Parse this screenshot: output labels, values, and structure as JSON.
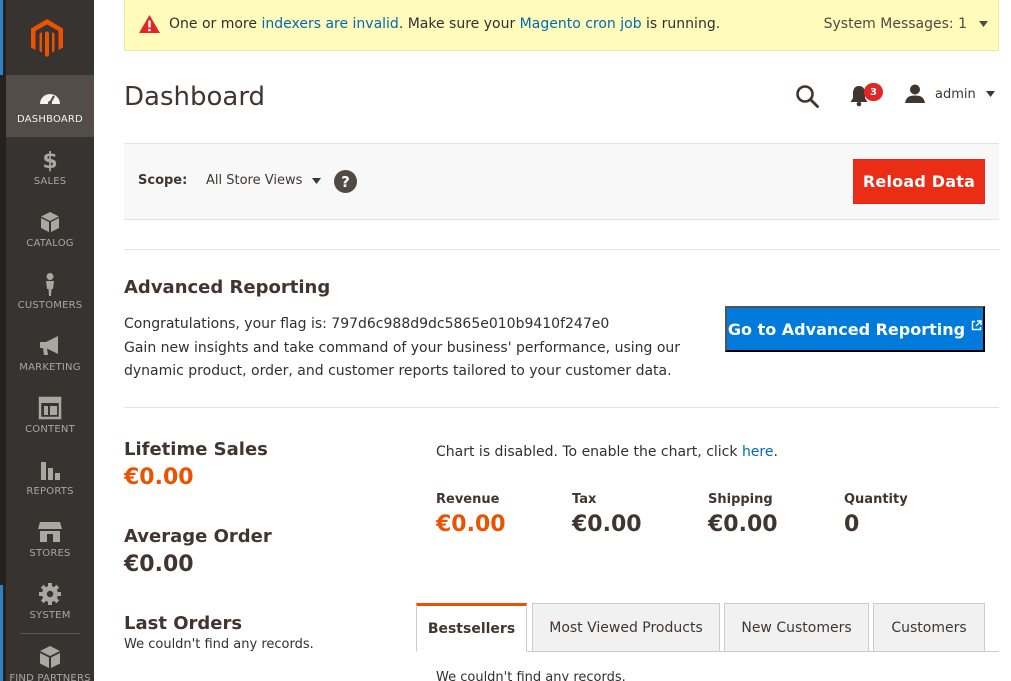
{
  "sidebar": {
    "logo": "magento-logo",
    "items": [
      {
        "label": "DASHBOARD",
        "icon": "dashboard-icon",
        "active": true
      },
      {
        "label": "SALES",
        "icon": "dollar-icon"
      },
      {
        "label": "CATALOG",
        "icon": "box-icon"
      },
      {
        "label": "CUSTOMERS",
        "icon": "person-icon"
      },
      {
        "label": "MARKETING",
        "icon": "megaphone-icon"
      },
      {
        "label": "CONTENT",
        "icon": "layout-icon"
      },
      {
        "label": "REPORTS",
        "icon": "bar-chart-icon"
      },
      {
        "label": "STORES",
        "icon": "store-icon"
      },
      {
        "label": "SYSTEM",
        "icon": "gear-icon"
      },
      {
        "label": "FIND PARTNERS",
        "icon": "partners-box-icon"
      }
    ]
  },
  "system_message": {
    "text_1": "One or more ",
    "link_1": "indexers are invalid",
    "text_2": ". Make sure your ",
    "link_2": "Magento cron job",
    "text_3": " is running.",
    "toggle_label": "System Messages: 1"
  },
  "header": {
    "title": "Dashboard",
    "notifications_count": "3",
    "user_name": "admin"
  },
  "scope": {
    "label": "Scope:",
    "value": "All Store Views",
    "help": "?",
    "reload_label": "Reload Data"
  },
  "advanced_reporting": {
    "title": "Advanced Reporting",
    "line_1": "Congratulations, your flag is: 797d6c988d9dc5865e010b9410f247e0",
    "line_2": "Gain new insights and take command of your business' performance, using our dynamic product, order, and customer reports tailored to your customer data.",
    "button_label": "Go to Advanced Reporting"
  },
  "stats": {
    "lifetime_sales_title": "Lifetime Sales",
    "lifetime_sales_value": "€0.00",
    "average_order_title": "Average Order",
    "average_order_value": "€0.00",
    "last_orders_title": "Last Orders",
    "last_orders_empty": "We couldn't find any records."
  },
  "chart": {
    "msg_text": "Chart is disabled. To enable the chart, click ",
    "msg_link": "here",
    "msg_end": "."
  },
  "totals": [
    {
      "label": "Revenue",
      "value": "€0.00",
      "accent": true
    },
    {
      "label": "Tax",
      "value": "€0.00"
    },
    {
      "label": "Shipping",
      "value": "€0.00"
    },
    {
      "label": "Quantity",
      "value": "0"
    }
  ],
  "tabs": {
    "items": [
      "Bestsellers",
      "Most Viewed Products",
      "New Customers",
      "Customers"
    ],
    "active": "Bestsellers",
    "empty_text": "We couldn't find any records."
  },
  "colors": {
    "sidebar_bg": "#373330",
    "accent_orange": "#eb5202",
    "reload_button": "#eb2d16",
    "link_blue": "#006bb4",
    "primary_blue": "#007bdb",
    "system_bar_bg": "#fffbbb"
  }
}
